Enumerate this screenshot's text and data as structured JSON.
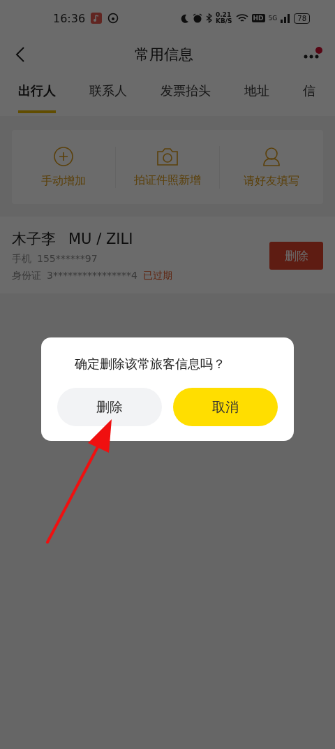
{
  "status_bar": {
    "time": "16:36",
    "net_speed": "0.21",
    "net_unit": "KB/S",
    "hd": "HD",
    "network": "5G",
    "battery": "78"
  },
  "nav": {
    "title": "常用信息",
    "has_notification": true
  },
  "tabs": [
    {
      "label": "出行人",
      "selected": true
    },
    {
      "label": "联系人",
      "selected": false
    },
    {
      "label": "发票抬头",
      "selected": false
    },
    {
      "label": "地址",
      "selected": false
    },
    {
      "label": "信",
      "selected": false
    }
  ],
  "actions": [
    {
      "kind": "add",
      "label": "手动增加"
    },
    {
      "kind": "camera",
      "label": "拍证件照新增"
    },
    {
      "kind": "friend",
      "label": "请好友填写"
    }
  ],
  "travelers": [
    {
      "name": "木子李",
      "pinyin": "MU / ZILI",
      "phone_label": "手机",
      "phone": "155******97",
      "id_label": "身份证",
      "id": "3****************4",
      "id_status": "已过期",
      "delete_label": "删除"
    }
  ],
  "dialog": {
    "message": "确定删除该常旅客信息吗？",
    "buttons": [
      {
        "kind": "secondary",
        "label": "删除"
      },
      {
        "kind": "primary",
        "label": "取消"
      }
    ]
  },
  "annotation": {
    "kind": "arrow"
  }
}
